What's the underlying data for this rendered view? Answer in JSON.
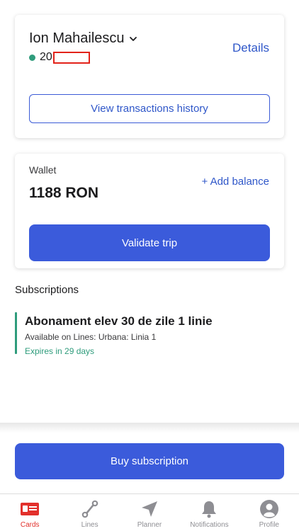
{
  "account": {
    "user_name": "Ion Mahailescu",
    "id_prefix": "20",
    "details_label": "Details",
    "history_label": "View transactions history"
  },
  "wallet": {
    "label": "Wallet",
    "amount": "1188 RON",
    "add_balance_label": "+ Add balance",
    "validate_label": "Validate trip"
  },
  "subscriptions": {
    "title": "Subscriptions",
    "items": [
      {
        "name": "Abonament elev 30 de zile 1 linie",
        "lines": "Available on Lines: Urbana: Linia 1",
        "expires": "Expires in 29 days",
        "status_color": "#2f9c7c"
      }
    ]
  },
  "buy_label": "Buy subscription",
  "tabs": [
    {
      "label": "Cards",
      "icon": "card-icon",
      "active": true
    },
    {
      "label": "Lines",
      "icon": "route-icon",
      "active": false
    },
    {
      "label": "Planner",
      "icon": "navigation-arrow-icon",
      "active": false
    },
    {
      "label": "Notifications",
      "icon": "bell-icon",
      "active": false
    },
    {
      "label": "Profile",
      "icon": "user-avatar-icon",
      "active": false
    }
  ],
  "colors": {
    "accent": "#3b5bdb",
    "link": "#2f57c9",
    "active_tab": "#e2302c",
    "inactive_tab": "#8e8e93",
    "status_green": "#2f9c7c"
  }
}
